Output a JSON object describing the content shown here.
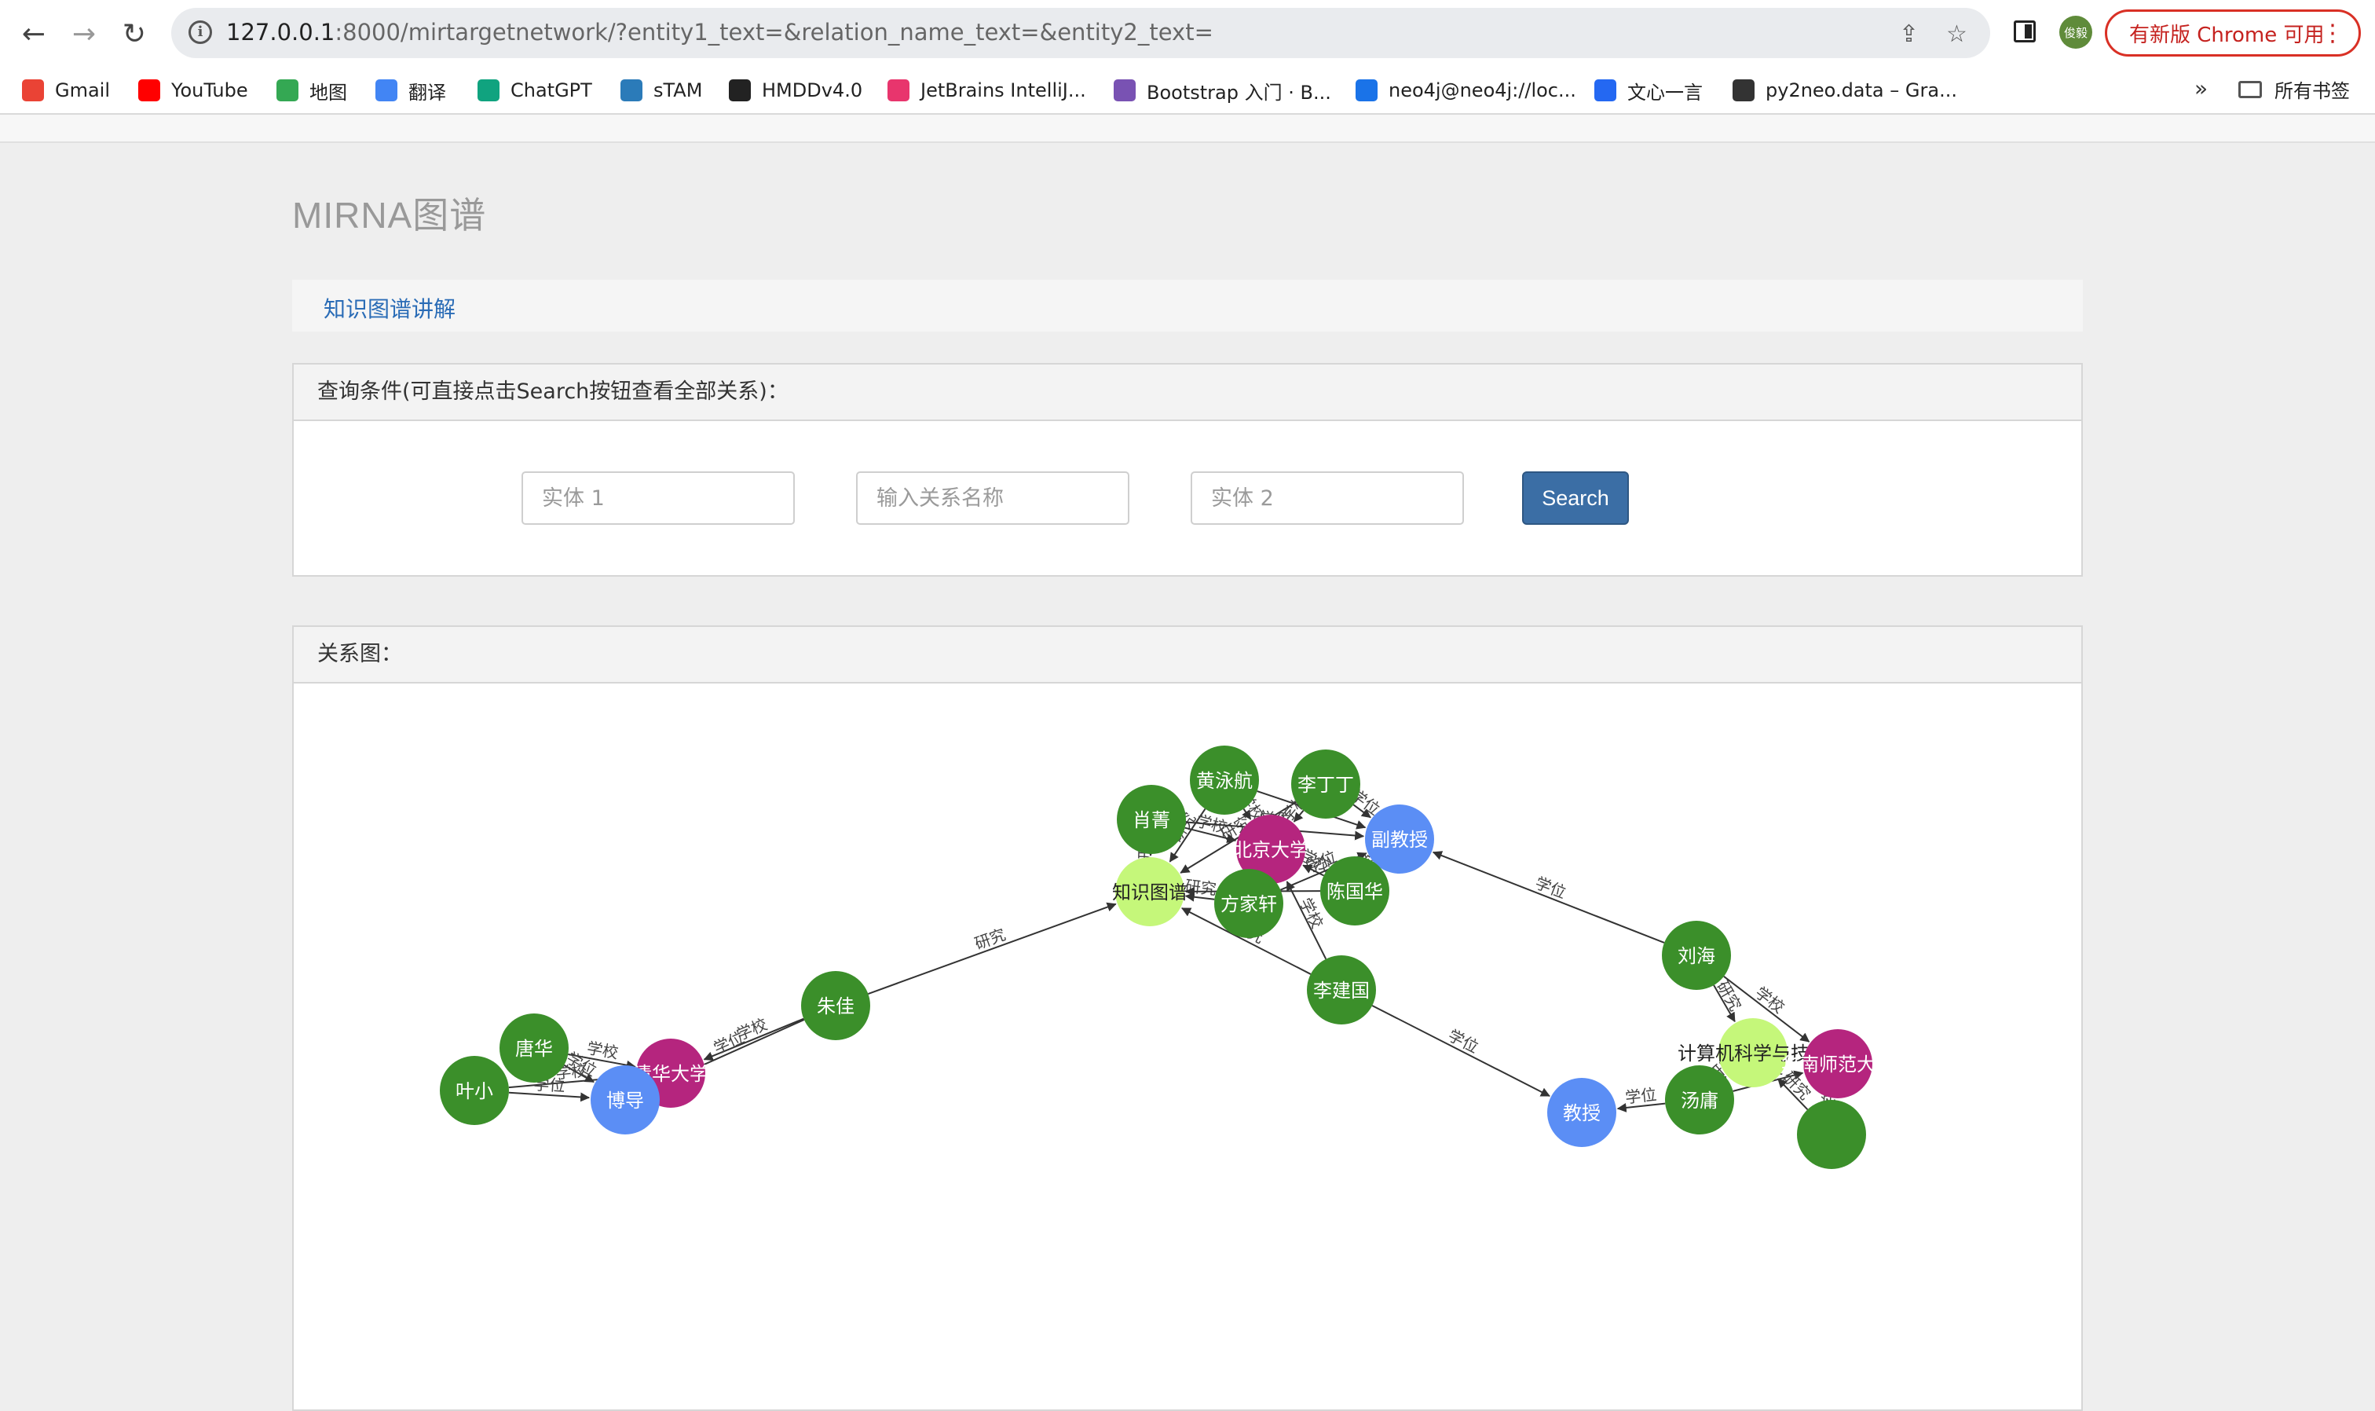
{
  "browser": {
    "url_host": "127.0.0.1",
    "url_rest": ":8000/mirtargetnetwork/?entity1_text=&relation_name_text=&entity2_text=",
    "profile_initials": "俊毅",
    "update_label": "有新版 Chrome 可用",
    "bookmarks": [
      {
        "label": "Gmail",
        "icon": "gmail-icon",
        "color": "#ea4335"
      },
      {
        "label": "YouTube",
        "icon": "youtube-icon",
        "color": "#ff0000"
      },
      {
        "label": "地图",
        "icon": "maps-icon",
        "color": "#34a853"
      },
      {
        "label": "翻译",
        "icon": "translate-icon",
        "color": "#4285f4"
      },
      {
        "label": "ChatGPT",
        "icon": "chatgpt-icon",
        "color": "#10a37f"
      },
      {
        "label": "sTAM",
        "icon": "stam-icon",
        "color": "#2b7bb9"
      },
      {
        "label": "HMDDv4.0",
        "icon": "globe-icon",
        "color": "#222222"
      },
      {
        "label": "JetBrains IntelliJ...",
        "icon": "jetbrains-icon",
        "color": "#e8356d"
      },
      {
        "label": "Bootstrap 入门 · B...",
        "icon": "bootstrap-icon",
        "color": "#7952b3"
      },
      {
        "label": "neo4j@neo4j://loc...",
        "icon": "terminal-icon",
        "color": "#1a73e8"
      },
      {
        "label": "文心一言",
        "icon": "wenxin-icon",
        "color": "#2468f2"
      },
      {
        "label": "py2neo.data – Gra...",
        "icon": "py2neo-icon",
        "color": "#333333"
      }
    ],
    "bookmarks_more": "»",
    "all_bookmarks": "所有书签"
  },
  "page": {
    "title": "MIRNA图谱",
    "tab_link": "知识图谱讲解",
    "query_heading": "查询条件(可直接点击Search按钮查看全部关系)：",
    "entity1_placeholder": "实体 1",
    "relation_placeholder": "输入关系名称",
    "entity2_placeholder": "实体 2",
    "search_label": "Search",
    "graph_heading": "关系图："
  },
  "graph": {
    "colors": {
      "person": "#3b8f2a",
      "school": "#b5257e",
      "title": "#5b8ef5",
      "topic": "#c5f77a",
      "edge": "#333333"
    },
    "nodes": [
      {
        "id": "huangyonghang",
        "label": "黄泳航",
        "type": "person"
      },
      {
        "id": "lidingding",
        "label": "李丁丁",
        "type": "person"
      },
      {
        "id": "xiaojing",
        "label": "肖菁",
        "type": "person"
      },
      {
        "id": "pku",
        "label": "北京大学",
        "type": "school"
      },
      {
        "id": "associate",
        "label": "副教授",
        "type": "title"
      },
      {
        "id": "kg",
        "label": "知识图谱",
        "type": "topic"
      },
      {
        "id": "fangjiaxuan",
        "label": "方家轩",
        "type": "person"
      },
      {
        "id": "chenguohua",
        "label": "陈国华",
        "type": "person"
      },
      {
        "id": "liuhai",
        "label": "刘海",
        "type": "person"
      },
      {
        "id": "lijianguo",
        "label": "李建国",
        "type": "person"
      },
      {
        "id": "zhujia",
        "label": "朱佳",
        "type": "person"
      },
      {
        "id": "tanghua",
        "label": "唐华",
        "type": "person"
      },
      {
        "id": "tsinghua",
        "label": "清华大学",
        "type": "school"
      },
      {
        "id": "yexiaohong",
        "label": "叶小",
        "type": "person"
      },
      {
        "id": "phdadvisor",
        "label": "博导",
        "type": "title"
      },
      {
        "id": "cs",
        "label": "计算机科学与技术",
        "type": "topic"
      },
      {
        "id": "scnu",
        "label": "华南师范大学",
        "type": "school"
      },
      {
        "id": "tangyong",
        "label": "汤庸",
        "type": "person"
      },
      {
        "id": "professor",
        "label": "教授",
        "type": "title"
      },
      {
        "id": "person_extra",
        "label": "",
        "type": "person"
      }
    ],
    "edges": [
      {
        "from": "huangyonghang",
        "to": "pku",
        "label": "学校"
      },
      {
        "from": "huangyonghang",
        "to": "associate",
        "label": "学位"
      },
      {
        "from": "huangyonghang",
        "to": "kg",
        "label": "研究"
      },
      {
        "from": "lidingding",
        "to": "pku",
        "label": "学校"
      },
      {
        "from": "lidingding",
        "to": "associate",
        "label": "学位"
      },
      {
        "from": "lidingding",
        "to": "kg",
        "label": "研究"
      },
      {
        "from": "xiaojing",
        "to": "pku",
        "label": "学校"
      },
      {
        "from": "xiaojing",
        "to": "associate",
        "label": "学位"
      },
      {
        "from": "xiaojing",
        "to": "kg",
        "label": "研究"
      },
      {
        "from": "fangjiaxuan",
        "to": "pku",
        "label": "学校"
      },
      {
        "from": "fangjiaxuan",
        "to": "associate",
        "label": "学位"
      },
      {
        "from": "fangjiaxuan",
        "to": "kg",
        "label": "研究"
      },
      {
        "from": "chenguohua",
        "to": "pku",
        "label": "学校"
      },
      {
        "from": "chenguohua",
        "to": "associate",
        "label": "学位"
      },
      {
        "from": "chenguohua",
        "to": "kg",
        "label": "研究"
      },
      {
        "from": "liuhai",
        "to": "associate",
        "label": "学位"
      },
      {
        "from": "liuhai",
        "to": "cs",
        "label": "研究"
      },
      {
        "from": "liuhai",
        "to": "scnu",
        "label": "学校"
      },
      {
        "from": "lijianguo",
        "to": "kg",
        "label": "研究"
      },
      {
        "from": "lijianguo",
        "to": "pku",
        "label": "学校"
      },
      {
        "from": "lijianguo",
        "to": "professor",
        "label": "学位"
      },
      {
        "from": "zhujia",
        "to": "kg",
        "label": "研究"
      },
      {
        "from": "zhujia",
        "to": "tsinghua",
        "label": "学校"
      },
      {
        "from": "zhujia",
        "to": "phdadvisor",
        "label": "学位"
      },
      {
        "from": "tanghua",
        "to": "tsinghua",
        "label": "学校"
      },
      {
        "from": "tanghua",
        "to": "phdadvisor",
        "label": "学位"
      },
      {
        "from": "yexiaohong",
        "to": "tsinghua",
        "label": "学校"
      },
      {
        "from": "yexiaohong",
        "to": "phdadvisor",
        "label": "学位"
      },
      {
        "from": "tangyong",
        "to": "cs",
        "label": "研究"
      },
      {
        "from": "tangyong",
        "to": "scnu",
        "label": "学校"
      },
      {
        "from": "tangyong",
        "to": "professor",
        "label": "学位"
      },
      {
        "from": "person_extra",
        "to": "scnu",
        "label": "学校"
      },
      {
        "from": "person_extra",
        "to": "cs",
        "label": "研究"
      }
    ]
  }
}
